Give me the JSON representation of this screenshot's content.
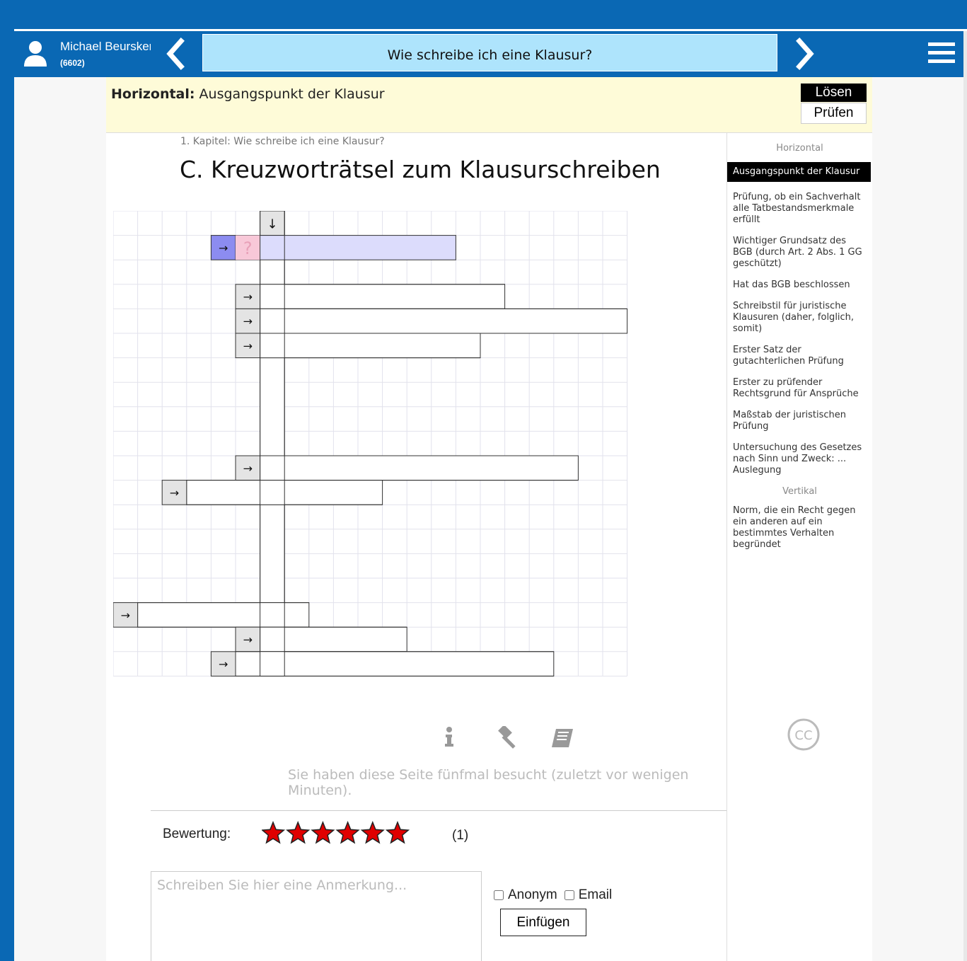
{
  "user": {
    "name": "Michael Beurskens",
    "id": "(6602)"
  },
  "header": {
    "title": "Wie schreibe ich eine Klausur?"
  },
  "cluebar": {
    "direction": "Horizontal:",
    "clue": "Ausgangspunkt der Klausur",
    "solve_label": "Lösen",
    "check_label": "Prüfen"
  },
  "breadcrumb": "1. Kapitel: Wie schreibe ich eine Klausur?",
  "page_title": "C. Kreuzworträtsel zum Klausurschreiben",
  "crossword": {
    "vertical_arrow": "↓",
    "across_arrow": "→",
    "active_placeholder": "?"
  },
  "footer": {
    "visit_text": "Sie haben diese Seite fünfmal besucht (zuletzt vor wenigen Minuten).",
    "rating_label": "Bewertung:",
    "rating_value": 6,
    "rating_max": 6,
    "rating_count": "(1)",
    "comment_placeholder": "Schreiben Sie hier eine Anmerkung...",
    "anon_label": "Anonym",
    "email_label": "Email",
    "submit_label": "Einfügen"
  },
  "sidebar": {
    "horizontal_heading": "Horizontal",
    "horizontal": [
      "Ausgangspunkt der Klausur",
      "Prüfung, ob ein Sachverhalt alle Tatbestandsmerkmale erfüllt",
      "Wichtiger Grundsatz des BGB (durch Art. 2 Abs. 1 GG geschützt)",
      "Hat das BGB beschlossen",
      "Schreibstil für juristische Klausuren (daher, folglich, somit)",
      "Erster Satz der gutachterlichen Prüfung",
      "Erster zu prüfender Rechtsgrund für Ansprüche",
      "Maßstab der juristischen Prüfung",
      "Untersuchung des Gesetzes nach Sinn und Zweck: ... Auslegung"
    ],
    "vertical_heading": "Vertikal",
    "vertical": [
      "Norm, die ein Recht gegen ein anderen auf ein bestimmtes Verhalten begründet"
    ],
    "cc_label": "CC"
  },
  "colors": {
    "brand_blue": "#0a68b4",
    "title_bg": "#aee4fc",
    "clue_bg": "#fefbd8",
    "active_word": "#dcdcfc",
    "active_cell": "#f8c8d8",
    "star": "#e00000"
  }
}
